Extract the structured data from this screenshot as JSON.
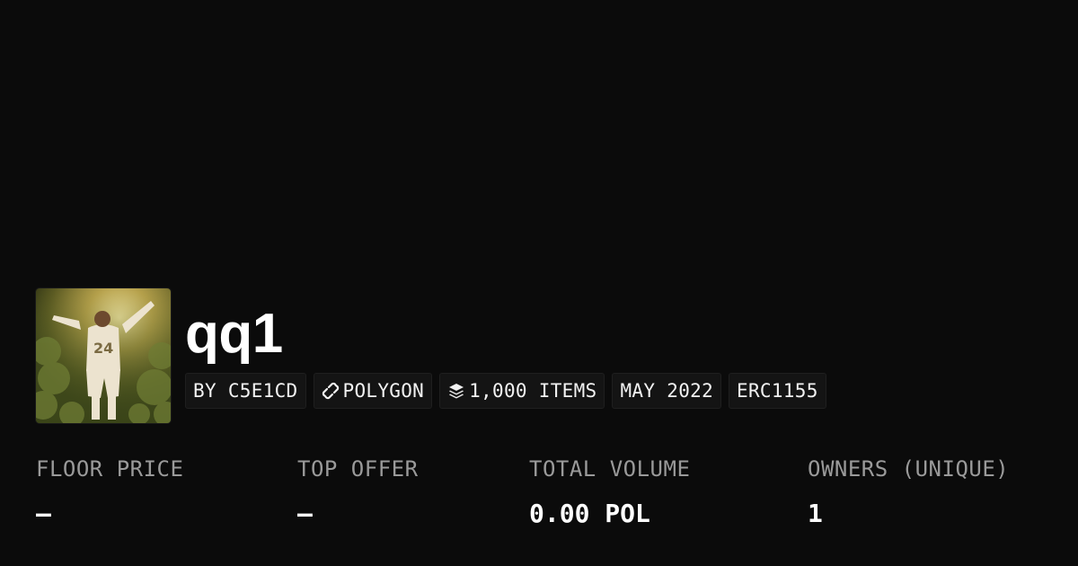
{
  "collection": {
    "name": "qq1",
    "avatar_alt": "collection-avatar"
  },
  "chips": [
    {
      "label": "BY C5E1CD",
      "icon": ""
    },
    {
      "label": "POLYGON",
      "icon": "chain-link-icon"
    },
    {
      "label": "1,000 ITEMS",
      "icon": "layers-icon"
    },
    {
      "label": "MAY 2022",
      "icon": ""
    },
    {
      "label": "ERC1155",
      "icon": ""
    }
  ],
  "stats": [
    {
      "label": "FLOOR PRICE",
      "value": "–"
    },
    {
      "label": "TOP OFFER",
      "value": "–"
    },
    {
      "label": "TOTAL VOLUME",
      "value": "0.00 POL"
    },
    {
      "label": "OWNERS (UNIQUE)",
      "value": "1"
    }
  ],
  "colors": {
    "background": "#0b0b0b",
    "chip_background": "#141414",
    "label_gray": "#9a9a9a",
    "text_white": "#ffffff"
  }
}
